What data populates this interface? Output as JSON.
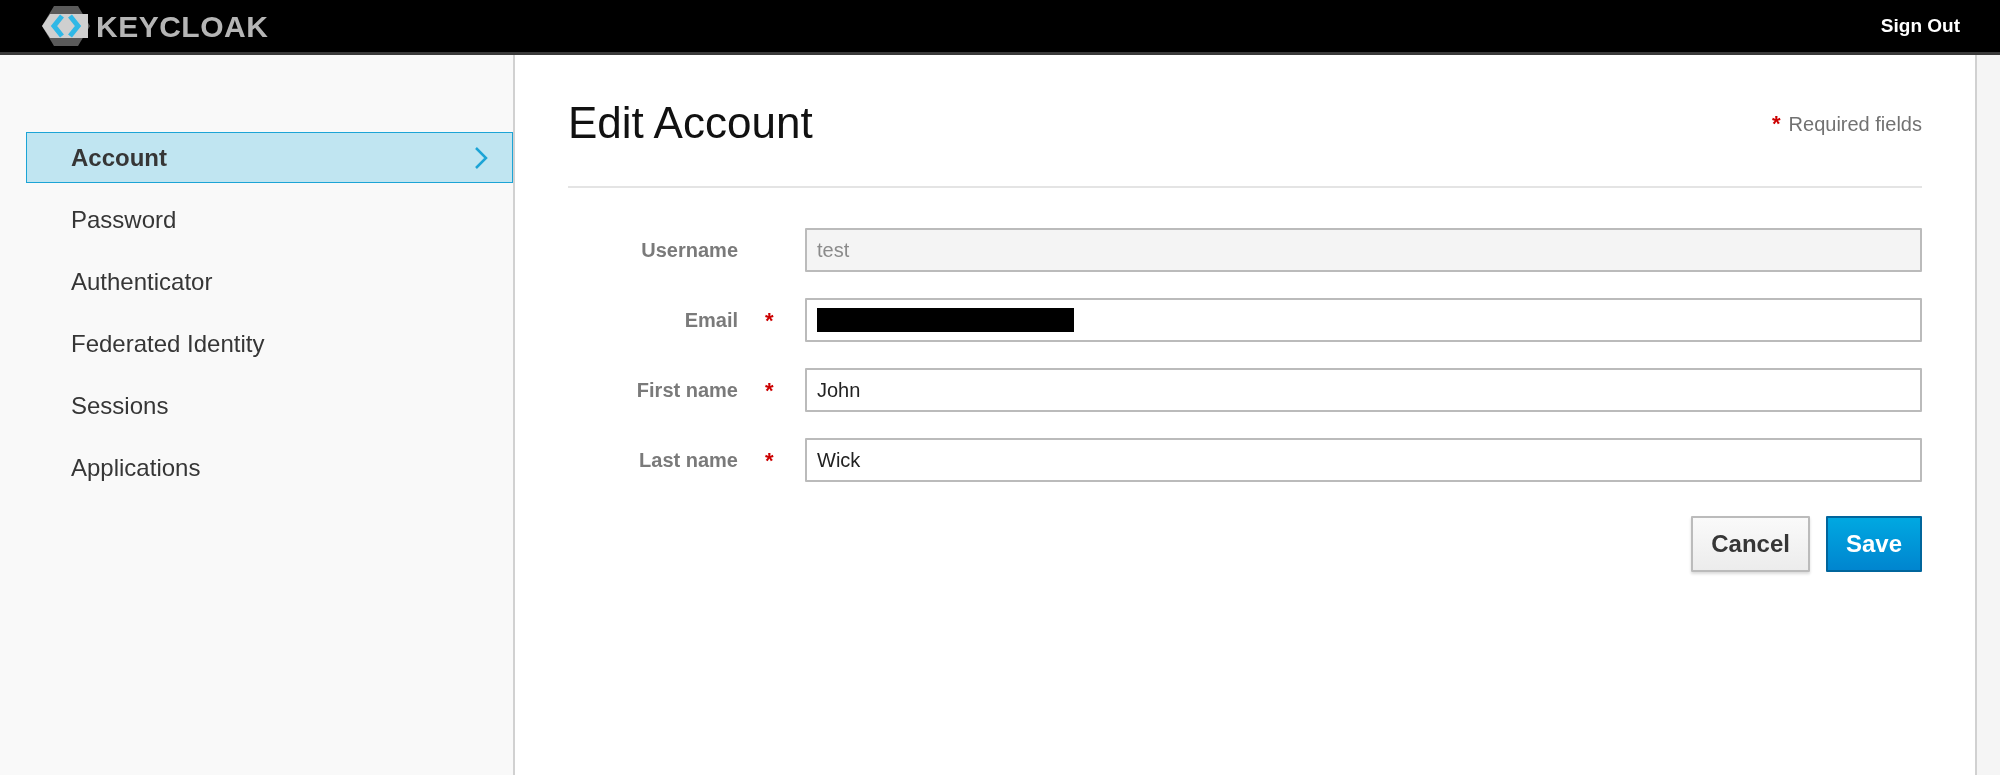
{
  "header": {
    "brand": "KEYCLOAK",
    "sign_out": "Sign Out"
  },
  "sidebar": {
    "items": [
      {
        "label": "Account",
        "selected": true
      },
      {
        "label": "Password",
        "selected": false
      },
      {
        "label": "Authenticator",
        "selected": false
      },
      {
        "label": "Federated Identity",
        "selected": false
      },
      {
        "label": "Sessions",
        "selected": false
      },
      {
        "label": "Applications",
        "selected": false
      }
    ]
  },
  "content": {
    "title": "Edit Account",
    "required_mark": "*",
    "required_note": "Required fields",
    "fields": [
      {
        "label": "Username",
        "value": "test",
        "required": false,
        "disabled": true,
        "redacted": false
      },
      {
        "label": "Email",
        "required": true,
        "disabled": false,
        "redacted": true
      },
      {
        "label": "First name",
        "value": "John",
        "required": true,
        "disabled": false,
        "redacted": false
      },
      {
        "label": "Last name",
        "value": "Wick",
        "required": true,
        "disabled": false,
        "redacted": false
      }
    ],
    "buttons": [
      {
        "label": "Cancel",
        "kind": "default"
      },
      {
        "label": "Save",
        "kind": "primary"
      }
    ]
  }
}
